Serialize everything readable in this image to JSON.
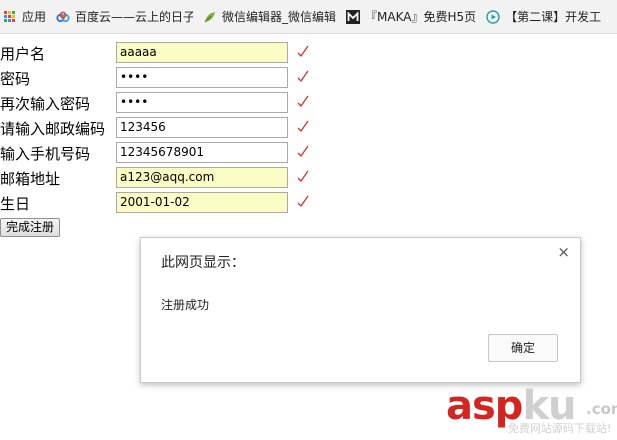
{
  "bookmarks": {
    "apps_label": "应用",
    "baidu_label": "百度云——云上的日子",
    "weixin_label": "微信编辑器_微信编辑",
    "maka_label": "『MAKA』免费H5页",
    "lesson_label": "【第二课】开发工"
  },
  "form": {
    "username_label": "用户名",
    "username_value": "aaaaa",
    "password_label": "密码",
    "password_value": "••••",
    "confirm_label": "再次输入密码",
    "confirm_value": "••••",
    "postal_label": "请输入邮政编码",
    "postal_value": "123456",
    "phone_label": "输入手机号码",
    "phone_value": "12345678901",
    "email_label": "邮箱地址",
    "email_value": "a123@aqq.com",
    "birthday_label": "生日",
    "birthday_value": "2001-01-02",
    "submit_label": "完成注册"
  },
  "dialog": {
    "title": "此网页显示：",
    "close_glyph": "×",
    "message": "注册成功",
    "ok_label": "确定"
  },
  "watermark": {
    "brand": "aspku",
    "domain": ".com",
    "tagline": "免费网站源码下载站!"
  },
  "colors": {
    "autofill_yellow": "#fbfbc4",
    "check_red": "#d9302a",
    "watermark_red": "#d32620"
  }
}
